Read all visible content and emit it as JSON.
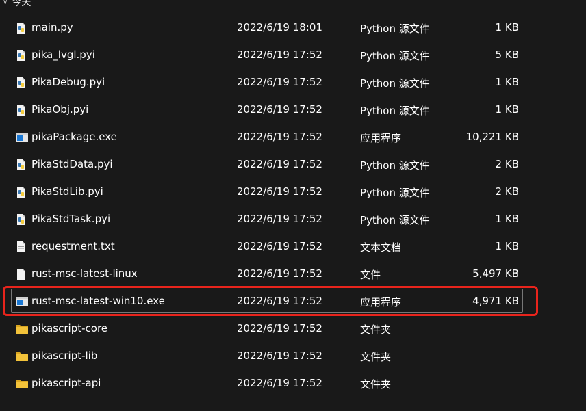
{
  "group": {
    "label": "今天"
  },
  "files": [
    {
      "name": "main.py",
      "date": "2022/6/19 18:01",
      "type": "Python 源文件",
      "size": "1 KB",
      "icon": "python-file-icon"
    },
    {
      "name": "pika_lvgl.pyi",
      "date": "2022/6/19 17:52",
      "type": "Python 源文件",
      "size": "5 KB",
      "icon": "python-file-icon"
    },
    {
      "name": "PikaDebug.pyi",
      "date": "2022/6/19 17:52",
      "type": "Python 源文件",
      "size": "1 KB",
      "icon": "python-file-icon"
    },
    {
      "name": "PikaObj.pyi",
      "date": "2022/6/19 17:52",
      "type": "Python 源文件",
      "size": "1 KB",
      "icon": "python-file-icon"
    },
    {
      "name": "pikaPackage.exe",
      "date": "2022/6/19 17:52",
      "type": "应用程序",
      "size": "10,221 KB",
      "icon": "exe-file-icon"
    },
    {
      "name": "PikaStdData.pyi",
      "date": "2022/6/19 17:52",
      "type": "Python 源文件",
      "size": "2 KB",
      "icon": "python-file-icon"
    },
    {
      "name": "PikaStdLib.pyi",
      "date": "2022/6/19 17:52",
      "type": "Python 源文件",
      "size": "2 KB",
      "icon": "python-file-icon"
    },
    {
      "name": "PikaStdTask.pyi",
      "date": "2022/6/19 17:52",
      "type": "Python 源文件",
      "size": "1 KB",
      "icon": "python-file-icon"
    },
    {
      "name": "requestment.txt",
      "date": "2022/6/19 17:52",
      "type": "文本文档",
      "size": "1 KB",
      "icon": "text-file-icon"
    },
    {
      "name": "rust-msc-latest-linux",
      "date": "2022/6/19 17:52",
      "type": "文件",
      "size": "5,497 KB",
      "icon": "blank-file-icon"
    },
    {
      "name": "rust-msc-latest-win10.exe",
      "date": "2022/6/19 17:52",
      "type": "应用程序",
      "size": "4,971 KB",
      "icon": "exe-file-icon",
      "selected": true
    },
    {
      "name": "pikascript-core",
      "date": "2022/6/19 17:52",
      "type": "文件夹",
      "size": "",
      "icon": "folder-icon"
    },
    {
      "name": "pikascript-lib",
      "date": "2022/6/19 17:52",
      "type": "文件夹",
      "size": "",
      "icon": "folder-icon"
    },
    {
      "name": "pikascript-api",
      "date": "2022/6/19 17:52",
      "type": "文件夹",
      "size": "",
      "icon": "folder-icon"
    }
  ],
  "colors": {
    "background": "#191919",
    "text": "#ffffff",
    "highlight": "#e8241c",
    "folder": "#f2c23a",
    "exe_accent": "#1a78d4",
    "python_blue": "#3a79b4",
    "python_yellow": "#f5cc3d"
  }
}
